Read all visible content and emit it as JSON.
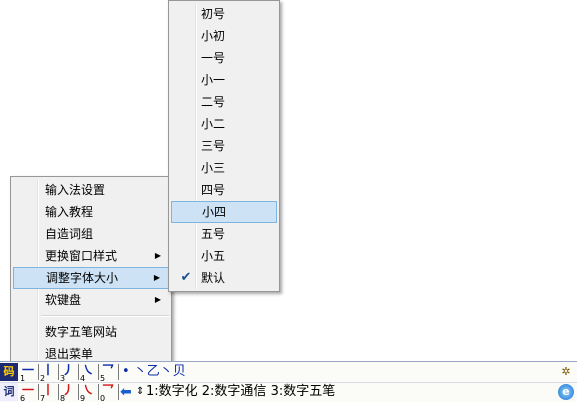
{
  "context_menu": {
    "items": [
      {
        "label": "输入法设置",
        "has_submenu": false
      },
      {
        "label": "输入教程",
        "has_submenu": false
      },
      {
        "label": "自造词组",
        "has_submenu": false
      },
      {
        "label": "更换窗口样式",
        "has_submenu": true
      },
      {
        "label": "调整字体大小",
        "has_submenu": true,
        "selected": true
      },
      {
        "label": "软键盘",
        "has_submenu": true
      },
      {
        "label": "数字五笔网站",
        "has_submenu": false
      },
      {
        "label": "退出菜单",
        "has_submenu": false
      }
    ],
    "submenu_arrow": "▶"
  },
  "font_size_menu": {
    "items": [
      {
        "label": "初号"
      },
      {
        "label": "小初"
      },
      {
        "label": "一号"
      },
      {
        "label": "小一"
      },
      {
        "label": "二号"
      },
      {
        "label": "小二"
      },
      {
        "label": "三号"
      },
      {
        "label": "小三"
      },
      {
        "label": "四号"
      },
      {
        "label": "小四",
        "hovered": true
      },
      {
        "label": "五号"
      },
      {
        "label": "小五"
      },
      {
        "label": "默认",
        "checked": true
      }
    ],
    "check_mark": "✔"
  },
  "ime_bar": {
    "row1": {
      "logo": "码",
      "keys": [
        {
          "glyph": "一",
          "num": "1"
        },
        {
          "glyph": "丨",
          "num": "2"
        },
        {
          "glyph": "丿",
          "num": "3"
        },
        {
          "glyph": "㇏",
          "num": "4"
        },
        {
          "glyph": "乛",
          "num": "5"
        }
      ],
      "strokes_text": "• 丶乙丶贝",
      "corner_icon": "gear-icon"
    },
    "row2": {
      "logo": "词",
      "keys": [
        {
          "glyph": "一",
          "num": "6"
        },
        {
          "glyph": "丨",
          "num": "7"
        },
        {
          "glyph": "丿",
          "num": "8"
        },
        {
          "glyph": "㇏",
          "num": "9"
        },
        {
          "glyph": "乛",
          "num": "0"
        }
      ],
      "arrow": "⬅",
      "updown": "⇕",
      "candidates": "1:数字化 2:数字通信 3:数字五笔",
      "corner_icon": "ie-globe-icon"
    }
  }
}
